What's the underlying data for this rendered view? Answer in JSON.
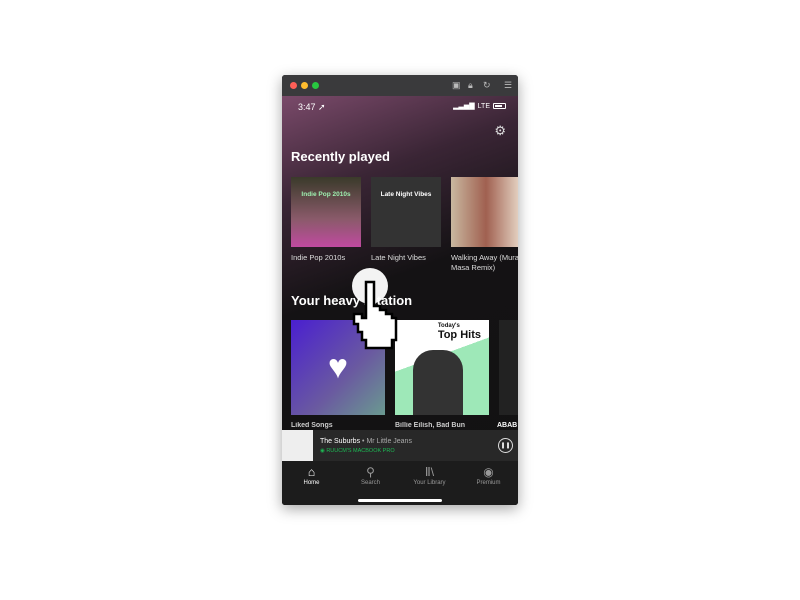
{
  "window": {
    "controls": [
      "close",
      "minimize",
      "maximize"
    ],
    "toolbar_icons": [
      "screenshot-icon",
      "lock-icon",
      "refresh-icon",
      "menu-icon"
    ]
  },
  "status": {
    "time": "3:47",
    "network": "LTE"
  },
  "recent": {
    "title": "Recently played",
    "items": [
      {
        "label": "Indie Pop 2010s",
        "art_text": "Indie Pop 2010s"
      },
      {
        "label": "Late Night Vibes",
        "art_text": "Late Night Vibes"
      },
      {
        "label": "Walking Away (Mura Masa Remix)"
      }
    ]
  },
  "heavy": {
    "title": "Your heavy rotation",
    "items": [
      {
        "label": "Liked Songs"
      },
      {
        "label": "Billie Eilish, Bad Bunny...",
        "art_text_small": "Today's",
        "art_text": "Top Hits"
      },
      {
        "label": "ABAB"
      }
    ]
  },
  "now_playing": {
    "title": "The Suburbs",
    "artist": "Mr Little Jeans",
    "separator": " • ",
    "device": "RUUCM'S MACBOOK PRO"
  },
  "tabs": [
    {
      "label": "Home"
    },
    {
      "label": "Search"
    },
    {
      "label": "Your Library"
    },
    {
      "label": "Premium"
    }
  ],
  "colors": {
    "accent": "#1db954"
  }
}
